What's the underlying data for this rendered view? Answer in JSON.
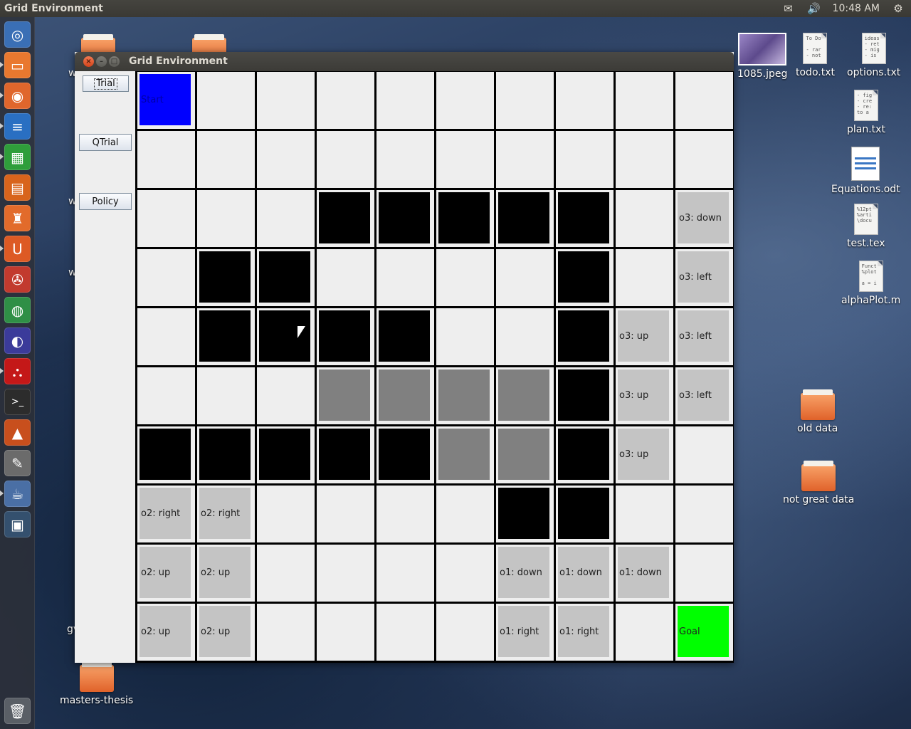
{
  "topbar": {
    "app_title": "Grid Environment",
    "clock": "10:48 AM",
    "mail_icon": "✉",
    "volume_icon": "🔊",
    "gear_icon": "⚙"
  },
  "launcher": {
    "items": [
      {
        "name": "ubuntu-dash-icon",
        "glyph": "◎",
        "color": "#3a6fb5"
      },
      {
        "name": "files-icon",
        "glyph": "▭",
        "color": "#e9782f"
      },
      {
        "name": "firefox-icon",
        "glyph": "◉",
        "color": "#e0662c"
      },
      {
        "name": "writer-icon",
        "glyph": "≡",
        "color": "#2a6fc2"
      },
      {
        "name": "calc-icon",
        "glyph": "▦",
        "color": "#2f9e3b"
      },
      {
        "name": "impress-icon",
        "glyph": "▤",
        "color": "#d8641c"
      },
      {
        "name": "software-center-icon",
        "glyph": "♜",
        "color": "#e26b2b"
      },
      {
        "name": "ubuntu-one-icon",
        "glyph": "U",
        "color": "#dd5a24"
      },
      {
        "name": "system-settings-icon",
        "glyph": "✇",
        "color": "#c23a2e"
      },
      {
        "name": "chrome-icon",
        "glyph": "◍",
        "color": "#2f8f46"
      },
      {
        "name": "eclipse-icon",
        "glyph": "◐",
        "color": "#3b3b9a"
      },
      {
        "name": "pdf-reader-icon",
        "glyph": "⛬",
        "color": "#c41818"
      },
      {
        "name": "terminal-icon",
        "glyph": ">_",
        "color": "#2c2c2c"
      },
      {
        "name": "matlab-icon",
        "glyph": "▲",
        "color": "#c84f1d"
      },
      {
        "name": "text-editor-icon",
        "glyph": "✎",
        "color": "#6b6b6b"
      },
      {
        "name": "java-app-icon",
        "glyph": "☕",
        "color": "#4a6fa5"
      },
      {
        "name": "workspace-switcher-icon",
        "glyph": "▣",
        "color": "#34506e"
      }
    ],
    "trash_icon": "🗑"
  },
  "window": {
    "title": "Grid Environment",
    "close_glyph": "×",
    "min_glyph": "–",
    "max_glyph": "□",
    "buttons": {
      "trial": "Trial",
      "qtrial": "QTrial",
      "policy": "Policy"
    }
  },
  "grid": {
    "rows": 10,
    "cols": 10,
    "colors": {
      "wall": "#000000",
      "gray": "#808080",
      "option": "#c4c4c4",
      "start": "#0000ff",
      "goal": "#00ff00",
      "empty": "#eeeeee"
    },
    "cells": [
      [
        {
          "k": "start",
          "t": "Start"
        },
        {
          "k": "empty",
          "t": ""
        },
        {
          "k": "empty",
          "t": ""
        },
        {
          "k": "empty",
          "t": ""
        },
        {
          "k": "empty",
          "t": ""
        },
        {
          "k": "empty",
          "t": ""
        },
        {
          "k": "empty",
          "t": ""
        },
        {
          "k": "empty",
          "t": ""
        },
        {
          "k": "empty",
          "t": ""
        },
        {
          "k": "empty",
          "t": ""
        }
      ],
      [
        {
          "k": "empty",
          "t": ""
        },
        {
          "k": "empty",
          "t": ""
        },
        {
          "k": "empty",
          "t": ""
        },
        {
          "k": "empty",
          "t": ""
        },
        {
          "k": "empty",
          "t": ""
        },
        {
          "k": "empty",
          "t": ""
        },
        {
          "k": "empty",
          "t": ""
        },
        {
          "k": "empty",
          "t": ""
        },
        {
          "k": "empty",
          "t": ""
        },
        {
          "k": "empty",
          "t": ""
        }
      ],
      [
        {
          "k": "empty",
          "t": ""
        },
        {
          "k": "empty",
          "t": ""
        },
        {
          "k": "empty",
          "t": ""
        },
        {
          "k": "wall",
          "t": ""
        },
        {
          "k": "wall",
          "t": ""
        },
        {
          "k": "wall",
          "t": ""
        },
        {
          "k": "wall",
          "t": ""
        },
        {
          "k": "wall",
          "t": ""
        },
        {
          "k": "empty",
          "t": ""
        },
        {
          "k": "opt",
          "t": "o3: down"
        }
      ],
      [
        {
          "k": "empty",
          "t": ""
        },
        {
          "k": "wall",
          "t": ""
        },
        {
          "k": "wall",
          "t": ""
        },
        {
          "k": "empty",
          "t": ""
        },
        {
          "k": "empty",
          "t": ""
        },
        {
          "k": "empty",
          "t": ""
        },
        {
          "k": "empty",
          "t": ""
        },
        {
          "k": "wall",
          "t": ""
        },
        {
          "k": "empty",
          "t": ""
        },
        {
          "k": "opt",
          "t": "o3: left"
        }
      ],
      [
        {
          "k": "empty",
          "t": ""
        },
        {
          "k": "wall",
          "t": ""
        },
        {
          "k": "wall",
          "t": ""
        },
        {
          "k": "wall",
          "t": ""
        },
        {
          "k": "wall",
          "t": ""
        },
        {
          "k": "empty",
          "t": ""
        },
        {
          "k": "empty",
          "t": ""
        },
        {
          "k": "wall",
          "t": ""
        },
        {
          "k": "opt",
          "t": "o3: up"
        },
        {
          "k": "opt",
          "t": "o3: left"
        }
      ],
      [
        {
          "k": "empty",
          "t": ""
        },
        {
          "k": "empty",
          "t": ""
        },
        {
          "k": "empty",
          "t": ""
        },
        {
          "k": "gray",
          "t": ""
        },
        {
          "k": "gray",
          "t": ""
        },
        {
          "k": "gray",
          "t": ""
        },
        {
          "k": "gray",
          "t": ""
        },
        {
          "k": "wall",
          "t": ""
        },
        {
          "k": "opt",
          "t": "o3: up"
        },
        {
          "k": "opt",
          "t": "o3: left"
        }
      ],
      [
        {
          "k": "wall",
          "t": ""
        },
        {
          "k": "wall",
          "t": ""
        },
        {
          "k": "wall",
          "t": ""
        },
        {
          "k": "wall",
          "t": ""
        },
        {
          "k": "wall",
          "t": ""
        },
        {
          "k": "gray",
          "t": ""
        },
        {
          "k": "gray",
          "t": ""
        },
        {
          "k": "wall",
          "t": ""
        },
        {
          "k": "opt",
          "t": "o3: up"
        },
        {
          "k": "empty",
          "t": ""
        }
      ],
      [
        {
          "k": "opt",
          "t": "o2: right"
        },
        {
          "k": "opt",
          "t": "o2: right"
        },
        {
          "k": "empty",
          "t": ""
        },
        {
          "k": "empty",
          "t": ""
        },
        {
          "k": "empty",
          "t": ""
        },
        {
          "k": "empty",
          "t": ""
        },
        {
          "k": "wall",
          "t": ""
        },
        {
          "k": "wall",
          "t": ""
        },
        {
          "k": "empty",
          "t": ""
        },
        {
          "k": "empty",
          "t": ""
        }
      ],
      [
        {
          "k": "opt",
          "t": "o2: up"
        },
        {
          "k": "opt",
          "t": "o2: up"
        },
        {
          "k": "empty",
          "t": ""
        },
        {
          "k": "empty",
          "t": ""
        },
        {
          "k": "empty",
          "t": ""
        },
        {
          "k": "empty",
          "t": ""
        },
        {
          "k": "opt",
          "t": "o1: down"
        },
        {
          "k": "opt",
          "t": "o1: down"
        },
        {
          "k": "opt",
          "t": "o1: down"
        },
        {
          "k": "empty",
          "t": ""
        }
      ],
      [
        {
          "k": "opt",
          "t": "o2: up"
        },
        {
          "k": "opt",
          "t": "o2: up"
        },
        {
          "k": "empty",
          "t": ""
        },
        {
          "k": "empty",
          "t": ""
        },
        {
          "k": "empty",
          "t": ""
        },
        {
          "k": "empty",
          "t": ""
        },
        {
          "k": "opt",
          "t": "o1: right"
        },
        {
          "k": "opt",
          "t": "o1: right"
        },
        {
          "k": "empty",
          "t": ""
        },
        {
          "k": "goal",
          "t": "Goal"
        }
      ]
    ]
  },
  "desktop": {
    "files": [
      {
        "label": "1085.jpeg",
        "kind": "image"
      },
      {
        "label": "todo.txt",
        "kind": "text",
        "preview": "To Do\n\n- rar\n- not"
      },
      {
        "label": "options.txt",
        "kind": "text",
        "preview": "ideas\n- ret\n- mig\n- is"
      },
      {
        "label": "plan.txt",
        "kind": "text",
        "preview": "- fig\n- cre\n- re:\nto a"
      },
      {
        "label": "Equations.odt",
        "kind": "odt"
      },
      {
        "label": "test.tex",
        "kind": "text",
        "preview": "%12pt\n%arti\n\\docu"
      },
      {
        "label": "alphaPlot.m",
        "kind": "text",
        "preview": "Funct\n%plot\n\na = i"
      },
      {
        "label": "old data",
        "kind": "folder"
      },
      {
        "label": "not great data",
        "kind": "folder"
      },
      {
        "label": "masters-thesis",
        "kind": "folder"
      }
    ],
    "partial_labels": [
      "w",
      "w",
      "w",
      "gv"
    ]
  }
}
